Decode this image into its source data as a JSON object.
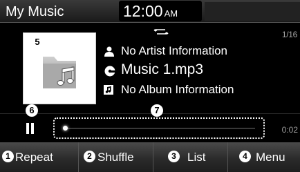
{
  "header": {
    "title": "My Music",
    "clock_time": "12:00",
    "clock_ampm": "AM"
  },
  "callouts": {
    "album_art": "5",
    "pause": "6",
    "progress": "7"
  },
  "main": {
    "track_position": "1/16",
    "repeat_icon": "repeat-icon",
    "artist": "No Artist Information",
    "title": "Music 1.mp3",
    "album": "No Album Information"
  },
  "progress": {
    "elapsed": "0:02",
    "fraction": 0.01
  },
  "footer": {
    "buttons": [
      {
        "number": "1",
        "label": "Repeat"
      },
      {
        "number": "2",
        "label": "Shuffle"
      },
      {
        "number": "3",
        "label": "List"
      },
      {
        "number": "4",
        "label": "Menu"
      }
    ]
  }
}
